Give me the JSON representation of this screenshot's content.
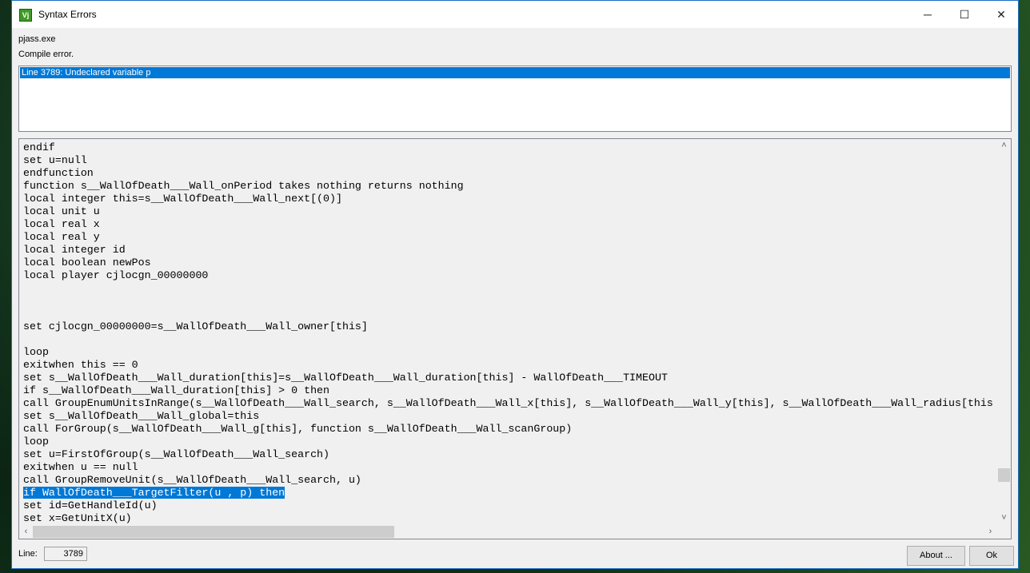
{
  "window": {
    "title": "Syntax Errors",
    "app_icon": "vjass-icon",
    "minimize": "─",
    "maximize": "☐",
    "close": "✕"
  },
  "header": {
    "tool": "pjass.exe",
    "status": "Compile error."
  },
  "errors": [
    {
      "text": "Line 3789:  Undeclared variable p",
      "selected": true
    }
  ],
  "code": {
    "highlighted_index": 27,
    "lines": [
      "endif",
      "set u=null",
      "endfunction",
      "function s__WallOfDeath___Wall_onPeriod takes nothing returns nothing",
      "local integer this=s__WallOfDeath___Wall_next[(0)]",
      "local unit u",
      "local real x",
      "local real y",
      "local integer id",
      "local boolean newPos",
      "local player cjlocgn_00000000",
      "",
      "",
      "",
      "set cjlocgn_00000000=s__WallOfDeath___Wall_owner[this]",
      "",
      "loop",
      "exitwhen this == 0",
      "set s__WallOfDeath___Wall_duration[this]=s__WallOfDeath___Wall_duration[this] - WallOfDeath___TIMEOUT",
      "if s__WallOfDeath___Wall_duration[this] > 0 then",
      "call GroupEnumUnitsInRange(s__WallOfDeath___Wall_search, s__WallOfDeath___Wall_x[this], s__WallOfDeath___Wall_y[this], s__WallOfDeath___Wall_radius[this",
      "set s__WallOfDeath___Wall_global=this",
      "call ForGroup(s__WallOfDeath___Wall_g[this], function s__WallOfDeath___Wall_scanGroup)",
      "loop",
      "set u=FirstOfGroup(s__WallOfDeath___Wall_search)",
      "exitwhen u == null",
      "call GroupRemoveUnit(s__WallOfDeath___Wall_search, u)",
      "if WallOfDeath___TargetFilter(u , p) then",
      "set id=GetHandleId(u)",
      "set x=GetUnitX(u)"
    ]
  },
  "footer": {
    "line_label": "Line:",
    "line_value": "3789",
    "about": "About ...",
    "ok": "Ok"
  },
  "scroll": {
    "arrows": {
      "up": "˄",
      "down": "˅",
      "left": "‹",
      "right": "›"
    }
  }
}
